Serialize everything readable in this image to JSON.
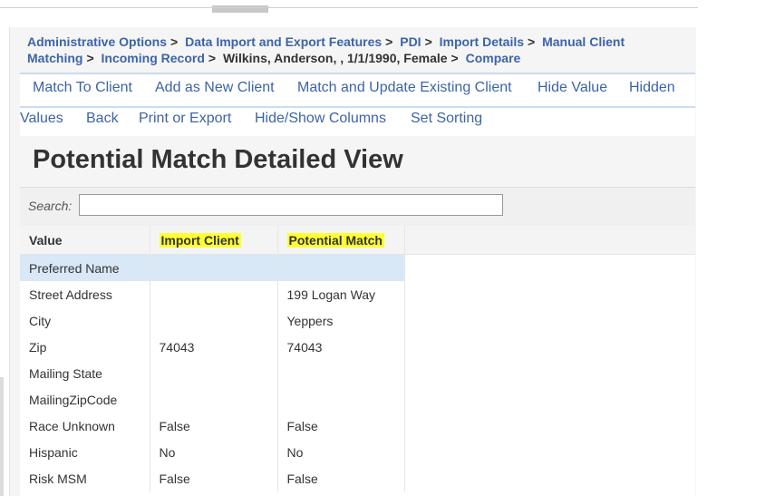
{
  "breadcrumb": {
    "items": [
      "Administrative Options",
      "Data Import and Export Features",
      "PDI",
      "Import Details",
      "Manual Client Matching",
      "Incoming Record",
      "Wilkins, Anderson, , 1/1/1990, Female",
      "Compare"
    ],
    "separator": ">"
  },
  "actions": {
    "match_to_client": "Match To Client",
    "add_as_new_client": "Add as New Client",
    "match_and_update": "Match and Update Existing Client",
    "hide_value": "Hide Value",
    "hidden": "Hidden",
    "values": "Values",
    "back": "Back",
    "print_or_export": "Print or Export",
    "hide_show_columns": "Hide/Show Columns",
    "set_sorting": "Set Sorting"
  },
  "page_title": "Potential Match Detailed View",
  "search": {
    "label": "Search:",
    "value": ""
  },
  "table": {
    "headers": [
      "Value",
      "Import Client",
      "Potential Match"
    ],
    "rows": [
      [
        "Preferred Name",
        "",
        ""
      ],
      [
        "Street Address",
        "",
        "199 Logan Way"
      ],
      [
        "City",
        "",
        "Yeppers"
      ],
      [
        "Zip",
        "74043",
        "74043"
      ],
      [
        "Mailing State",
        "",
        ""
      ],
      [
        "MailingZipCode",
        "",
        ""
      ],
      [
        "Race Unknown",
        "False",
        "False"
      ],
      [
        "Hispanic",
        "No",
        "No"
      ],
      [
        "Risk MSM",
        "False",
        "False"
      ]
    ]
  },
  "colors": {
    "link": "#3c64a8",
    "highlight": "#ffff33",
    "selected_row": "#d9e8f6"
  }
}
